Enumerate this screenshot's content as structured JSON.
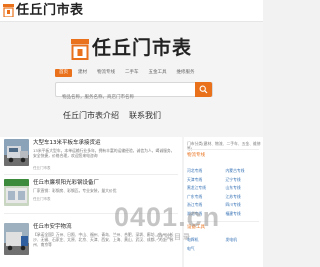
{
  "header": {
    "site_name": "任丘门市表"
  },
  "hero": {
    "site_name": "任丘门市表",
    "tabs": [
      "首页",
      "建材",
      "物流专线",
      "二手车",
      "五金工具",
      "维修服务"
    ],
    "search_placeholder": "物品名称，服务名称，商店门市名称",
    "nav_links": [
      "任丘门市表介绍",
      "联系我们"
    ]
  },
  "articles": [
    {
      "title": "大型车13米平板车承接货运",
      "desc": "13米平板大型车，本单运输行业多年，拥有丰富的运输经验，诚信为人，竭诚服务，安全快捷，价格合理，欢迎您来电咨询",
      "meta": "任丘门市表"
    },
    {
      "title": "任丘市廉坝阳光彩钢设备厂",
      "desc": "厂家直销：彩钢房、彩钢瓦，专业安装，量大价优",
      "meta": "任丘门市表"
    },
    {
      "title": "任丘市安宇物流",
      "desc": "【承诺全国】万州、日照、中山、福州、青岛、兰州、合肥、深圳、廊坊、杭州、长沙、无锡、石家庄、太原、北京、天津、西安、上海、黄山、武汉、成都、大连、苏州、南京等",
      "meta": ""
    }
  ],
  "sidebar": {
    "categories": "门市分类(建材、物流、二手车、五金、维修等)",
    "logistics_title": "物流专线",
    "links": [
      "河北专线",
      "内蒙古专线",
      "天津专线",
      "辽宁专线",
      "黑龙江专线",
      "山东专线",
      "广东专线",
      "江苏专线",
      "浙江专线",
      "四川专线",
      "湖北专线",
      "福建专线"
    ],
    "equipment_title": "设备工具",
    "equipment_links": [
      "电焊机",
      "发电机",
      "电气"
    ]
  },
  "watermark": {
    "main": "0401.cn",
    "sub": "分类目录"
  },
  "colors": {
    "accent": "#e9711c",
    "link": "#2f6db3"
  },
  "icons": {
    "logo": "storefront-icon",
    "search": "search-icon"
  }
}
